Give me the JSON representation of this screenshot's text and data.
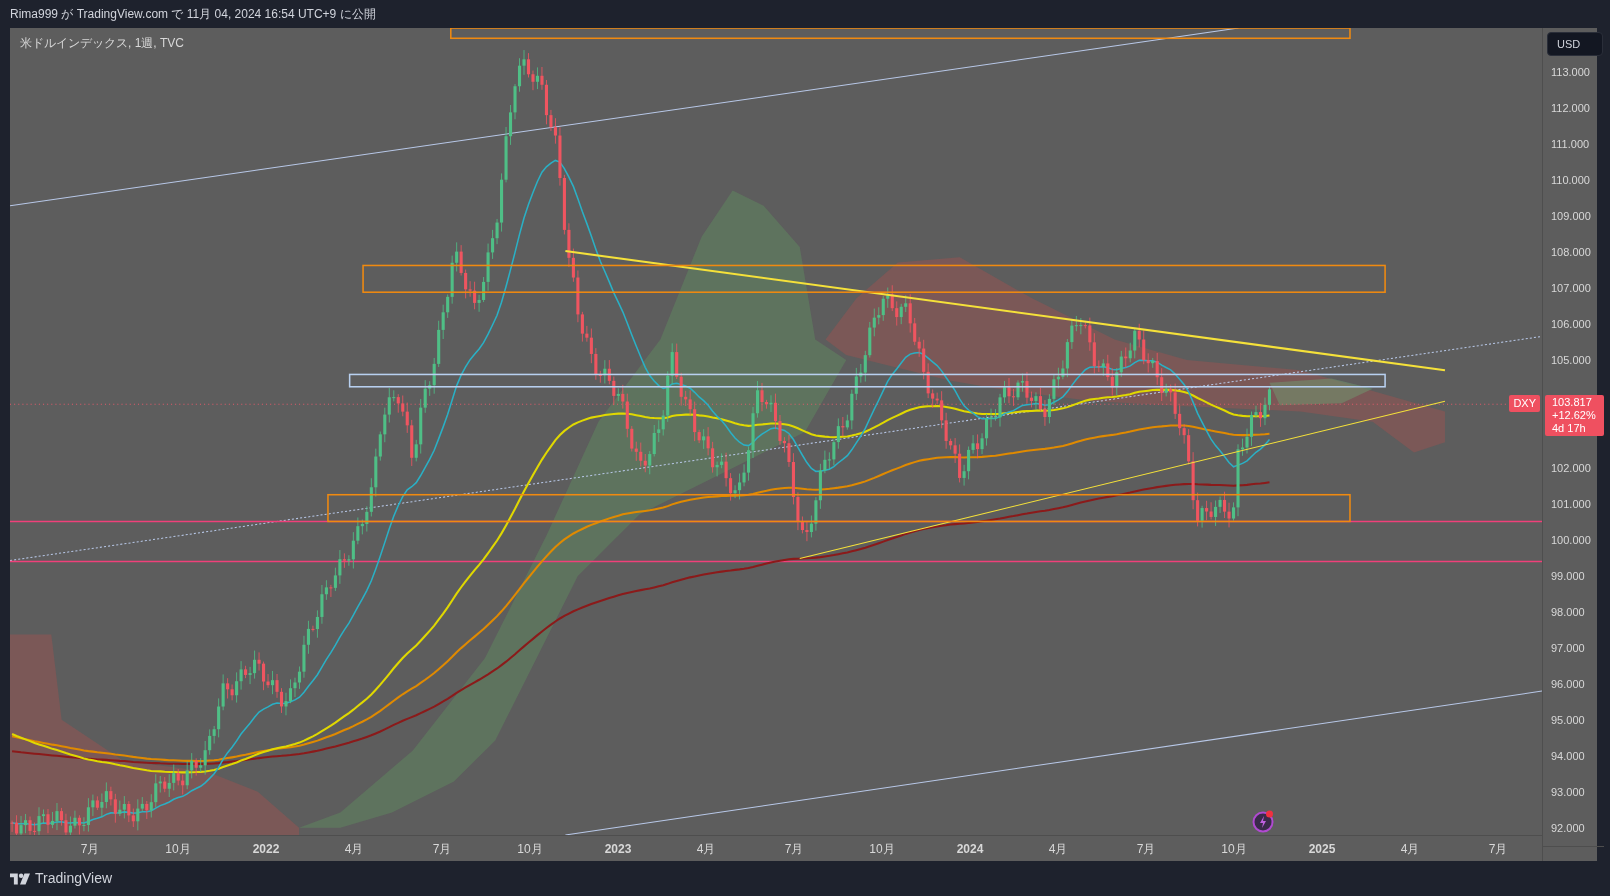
{
  "header": {
    "title": "Rima999 が TradingView.com で 11月 04, 2024 16:54 UTC+9 に公開"
  },
  "chart": {
    "legend": "米ドルインデックス, 1週, TVC",
    "symbol_tag": "DXY",
    "price_tag": [
      "103.817",
      "+12.62%",
      "4d 17h"
    ]
  },
  "price_axis": {
    "currency_button": "USD",
    "labels_above_tag": [
      "113.000",
      "112.000",
      "111.000",
      "110.000",
      "109.000",
      "108.000",
      "107.000",
      "106.000",
      "105.000"
    ],
    "labels_below_tag": [
      "102.000",
      "101.000",
      "100.000",
      "99.000",
      "98.000",
      "97.000",
      "96.000",
      "95.000",
      "94.000",
      "93.000",
      "92.000"
    ]
  },
  "time_axis": {
    "labels": [
      {
        "text": "7月",
        "kind": "month"
      },
      {
        "text": "10月",
        "kind": "month"
      },
      {
        "text": "2022",
        "kind": "year"
      },
      {
        "text": "4月",
        "kind": "month"
      },
      {
        "text": "7月",
        "kind": "month"
      },
      {
        "text": "10月",
        "kind": "month"
      },
      {
        "text": "2023",
        "kind": "year"
      },
      {
        "text": "4月",
        "kind": "month"
      },
      {
        "text": "7月",
        "kind": "month"
      },
      {
        "text": "10月",
        "kind": "month"
      },
      {
        "text": "2024",
        "kind": "year"
      },
      {
        "text": "4月",
        "kind": "month"
      },
      {
        "text": "7月",
        "kind": "month"
      },
      {
        "text": "10月",
        "kind": "month"
      },
      {
        "text": "2025",
        "kind": "year"
      },
      {
        "text": "4月",
        "kind": "month"
      },
      {
        "text": "7月",
        "kind": "month"
      }
    ]
  },
  "footer": {
    "logo_text": "TradingView"
  }
}
